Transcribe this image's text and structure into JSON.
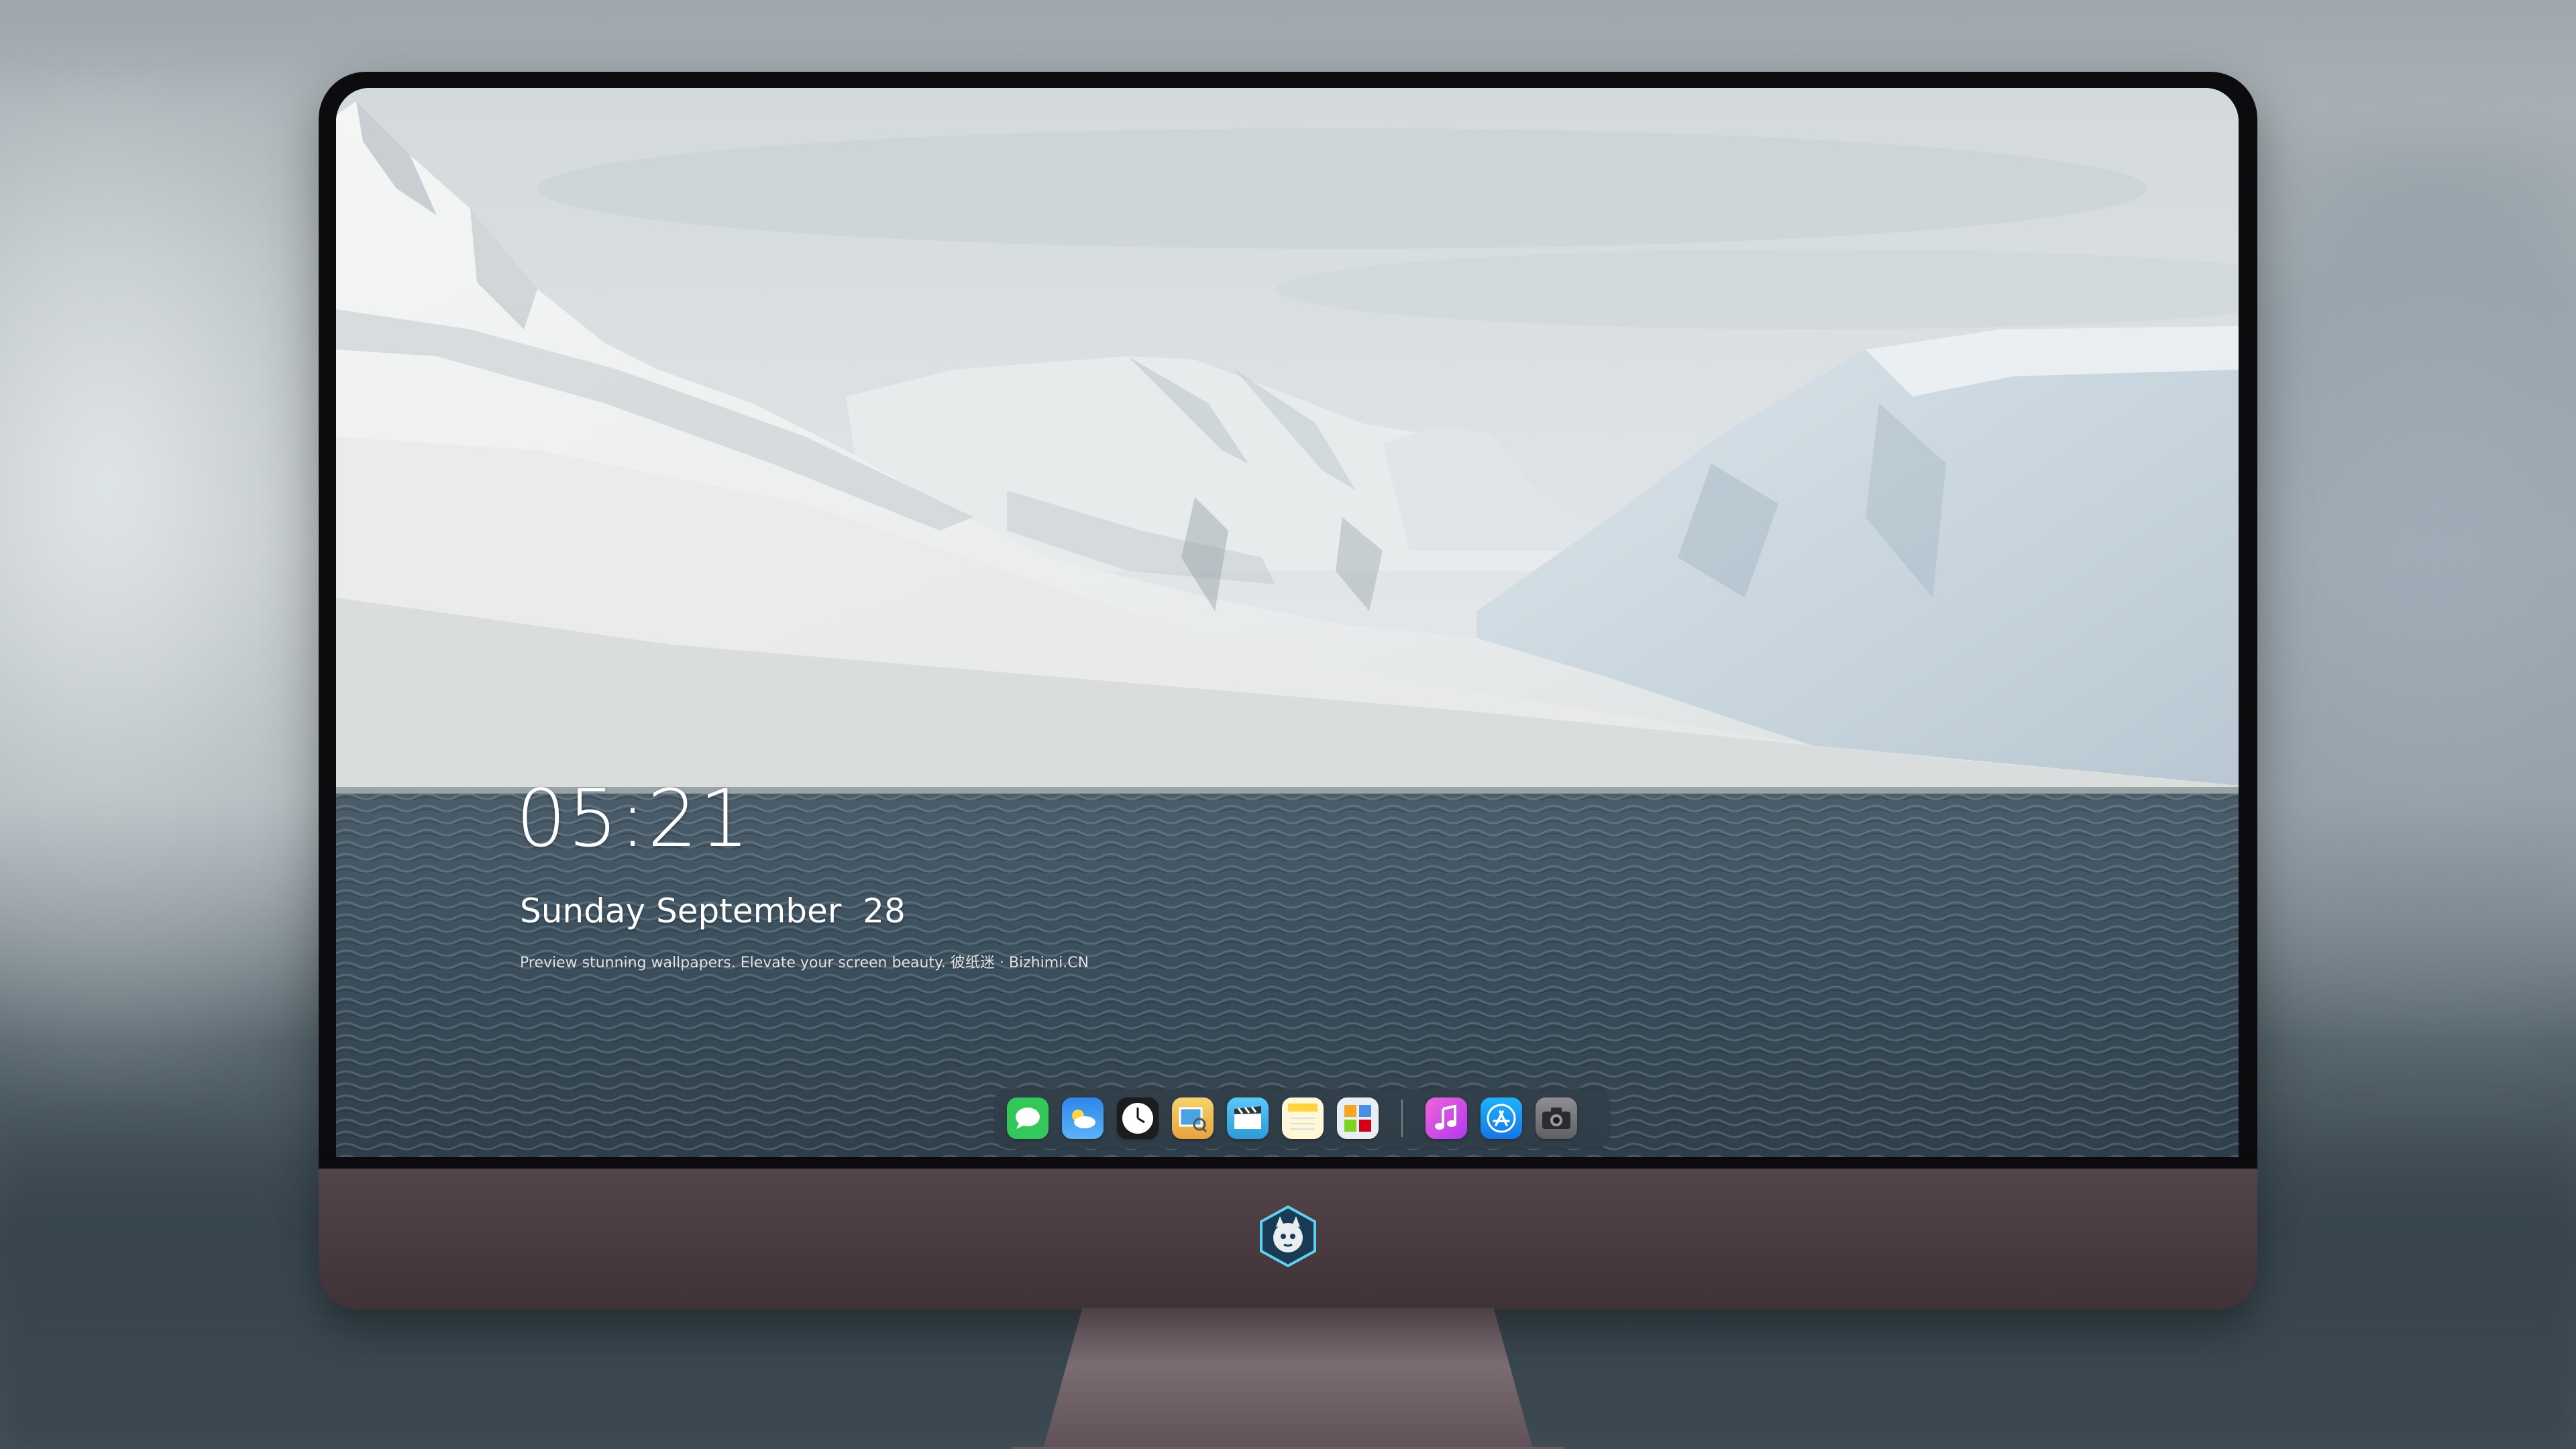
{
  "lockscreen": {
    "time": "05:21",
    "date": "Sunday September  28",
    "tagline": "Preview stunning wallpapers. Elevate your screen beauty. 彼纸迷 · Bizhimi.CN"
  },
  "dock": {
    "apps": [
      {
        "name": "messages-icon",
        "color": "#34c759"
      },
      {
        "name": "weather-icon",
        "color": "#2f8cf0"
      },
      {
        "name": "clock-icon",
        "color": "#1c1c1e"
      },
      {
        "name": "preview-icon",
        "color": "#f2c94c"
      },
      {
        "name": "final-cut-icon",
        "color": "#5ac8fa"
      },
      {
        "name": "notes-icon",
        "color": "#ffd54a"
      },
      {
        "name": "photo-booth-icon",
        "color": "#e9eef2"
      },
      {
        "name": "itunes-icon",
        "color": "#e53ad8"
      },
      {
        "name": "app-store-icon",
        "color": "#1c8ef9"
      },
      {
        "name": "camera-icon",
        "color": "#6d6d72"
      }
    ]
  },
  "colors": {
    "monitor_bezel": "#0c0c0e",
    "monitor_chin": "#4a3c42",
    "sea": "#3d505e",
    "snow": "#eef1f2",
    "sky": "#dfe4e6"
  }
}
